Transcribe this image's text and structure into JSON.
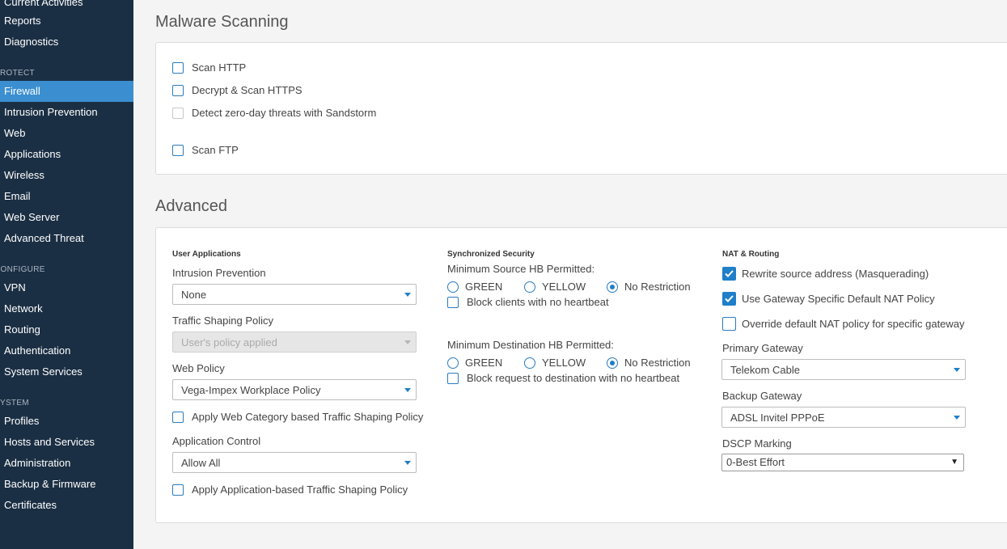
{
  "sidebar": {
    "top_items": [
      "Current Activities",
      "Reports",
      "Diagnostics"
    ],
    "sections": [
      {
        "heading": "PROTECT",
        "items": [
          "Firewall",
          "Intrusion Prevention",
          "Web",
          "Applications",
          "Wireless",
          "Email",
          "Web Server",
          "Advanced Threat"
        ]
      },
      {
        "heading": "CONFIGURE",
        "items": [
          "VPN",
          "Network",
          "Routing",
          "Authentication",
          "System Services"
        ]
      },
      {
        "heading": "SYSTEM",
        "items": [
          "Profiles",
          "Hosts and Services",
          "Administration",
          "Backup & Firmware",
          "Certificates"
        ]
      }
    ],
    "active_item": "Firewall"
  },
  "malware": {
    "title": "Malware Scanning",
    "options": [
      {
        "label": "Scan HTTP",
        "checked": false,
        "disabled": false
      },
      {
        "label": "Decrypt & Scan HTTPS",
        "checked": false,
        "disabled": false
      },
      {
        "label": "Detect zero-day threats with Sandstorm",
        "checked": false,
        "disabled": true
      },
      {
        "label": "Scan FTP",
        "checked": false,
        "disabled": false
      }
    ]
  },
  "advanced": {
    "title": "Advanced",
    "user_apps": {
      "heading": "User Applications",
      "ips_label": "Intrusion Prevention",
      "ips_value": "None",
      "traffic_label": "Traffic Shaping Policy",
      "traffic_value": "User's policy applied",
      "web_label": "Web Policy",
      "web_value": "Vega-Impex Workplace Policy",
      "web_cat_label": "Apply Web Category based Traffic Shaping Policy",
      "app_control_label": "Application Control",
      "app_control_value": "Allow All",
      "app_shaping_label": "Apply Application-based Traffic Shaping Policy"
    },
    "sync": {
      "heading": "Synchronized Security",
      "source_label": "Minimum Source HB Permitted:",
      "dest_label": "Minimum Destination HB Permitted:",
      "radio_options": [
        "GREEN",
        "YELLOW",
        "No Restriction"
      ],
      "source_selected": "No Restriction",
      "dest_selected": "No Restriction",
      "block_clients_label": "Block clients with no heartbeat",
      "block_request_label": "Block request to destination with no heartbeat"
    },
    "nat": {
      "heading": "NAT & Routing",
      "rewrite_label": "Rewrite source address (Masquerading)",
      "rewrite_checked": true,
      "gateway_nat_label": "Use Gateway Specific Default NAT Policy",
      "gateway_nat_checked": true,
      "override_label": "Override default NAT policy for specific gateway",
      "override_checked": false,
      "primary_label": "Primary Gateway",
      "primary_value": "Telekom Cable",
      "backup_label": "Backup Gateway",
      "backup_value": "ADSL Invitel PPPoE",
      "dscp_label": "DSCP Marking",
      "dscp_value": "0-Best Effort"
    }
  },
  "colors": {
    "sidebar_bg": "#1b2f44",
    "active_bg": "#3b8fd1",
    "accent": "#1f7fc8"
  }
}
